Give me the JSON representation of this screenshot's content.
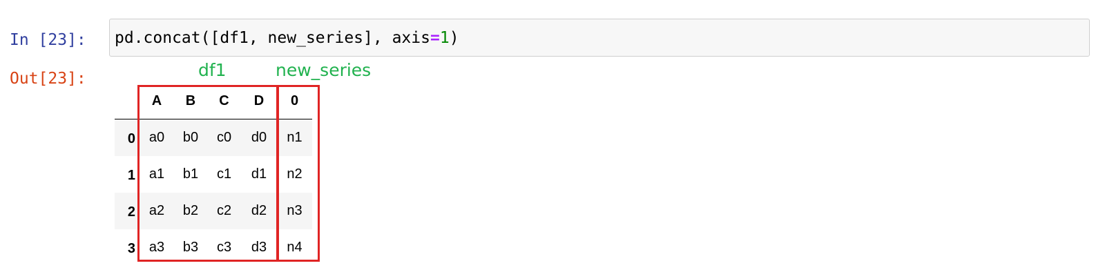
{
  "notebook": {
    "in_prompt": "In [23]:",
    "out_prompt": "Out[23]:",
    "code": {
      "before_op": "pd.concat([df1, new_series], axis",
      "op": "=",
      "number": "1",
      "after": ")"
    }
  },
  "annotations": {
    "df1_label": "df1",
    "series_label": "new_series",
    "box_color": "#e02424",
    "label_color": "#21b24f"
  },
  "output_table": {
    "columns": [
      "A",
      "B",
      "C",
      "D",
      "0"
    ],
    "rows": [
      {
        "index": "0",
        "cells": [
          "a0",
          "b0",
          "c0",
          "d0",
          "n1"
        ]
      },
      {
        "index": "1",
        "cells": [
          "a1",
          "b1",
          "c1",
          "d1",
          "n2"
        ]
      },
      {
        "index": "2",
        "cells": [
          "a2",
          "b2",
          "c2",
          "d2",
          "n3"
        ]
      },
      {
        "index": "3",
        "cells": [
          "a3",
          "b3",
          "c3",
          "d3",
          "n4"
        ]
      }
    ]
  }
}
